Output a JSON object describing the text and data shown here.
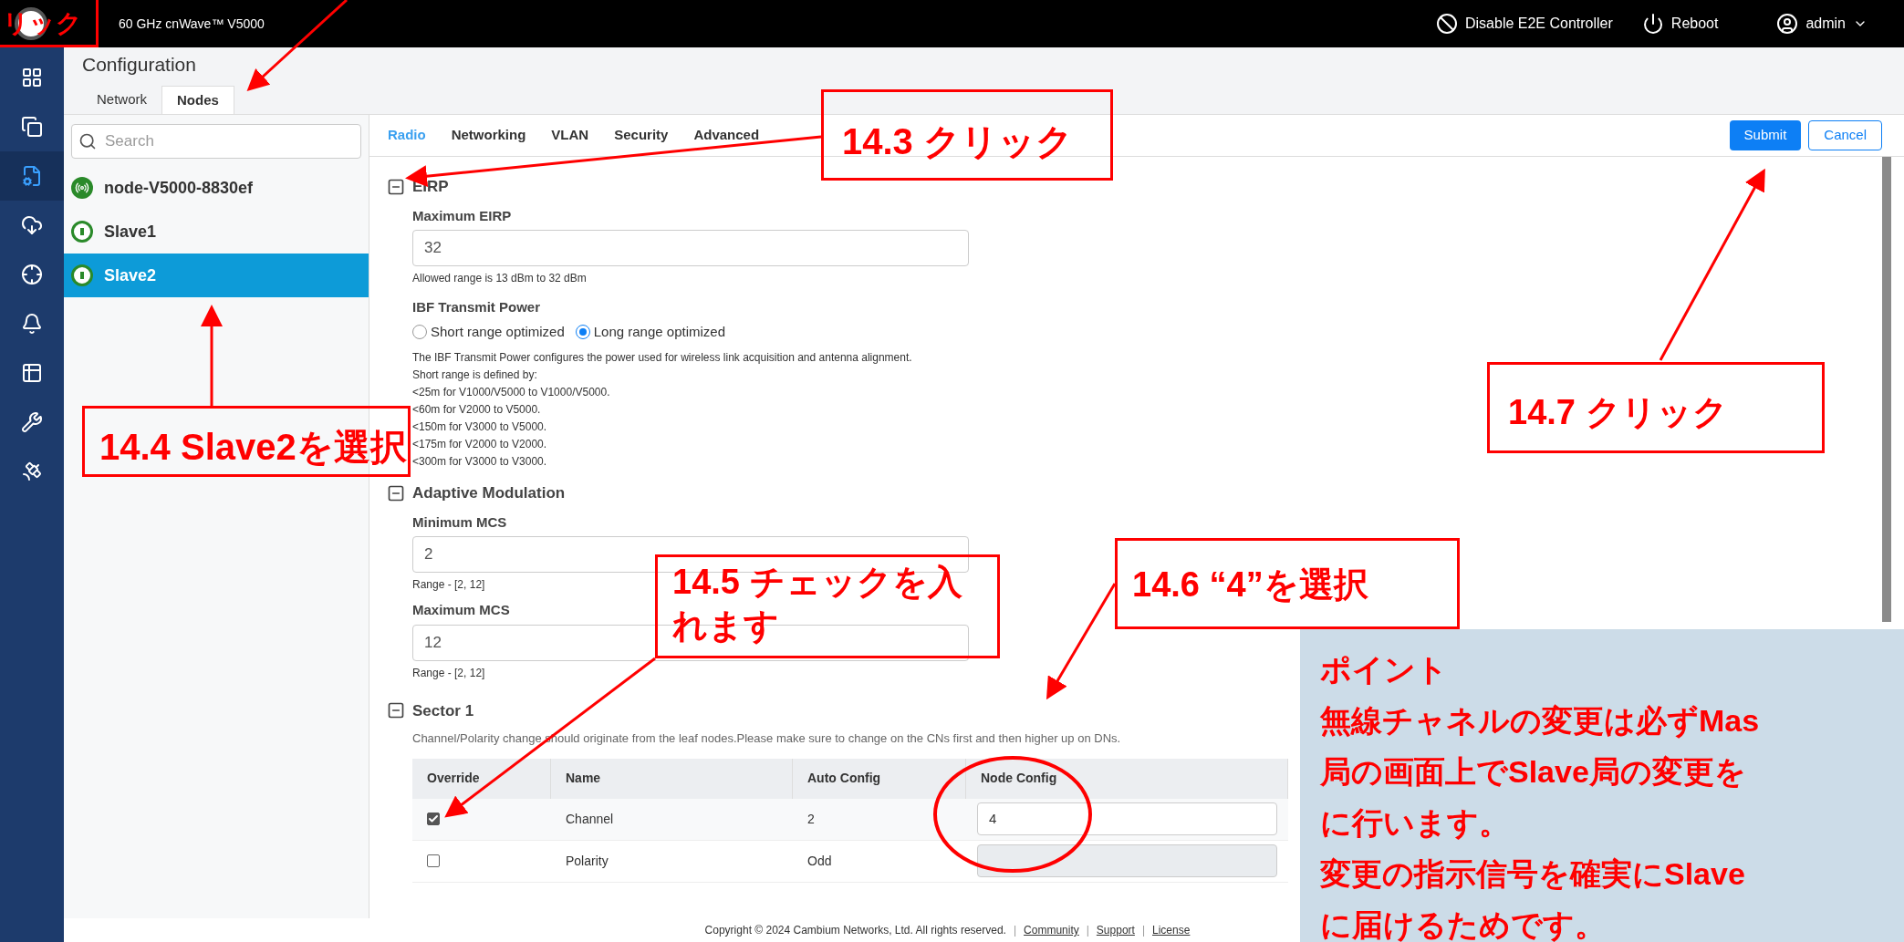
{
  "topbar": {
    "product": "60 GHz cnWave™ V5000",
    "actions": [
      "Disable E2E Controller",
      "Reboot"
    ],
    "user": "admin"
  },
  "nav": [
    {
      "selected": false
    },
    {
      "selected": false
    },
    {
      "selected": true
    },
    {
      "selected": false
    },
    {
      "selected": false
    },
    {
      "selected": false
    },
    {
      "selected": false
    },
    {
      "selected": false
    },
    {
      "selected": false
    }
  ],
  "page": {
    "title": "Configuration",
    "tabs": [
      {
        "label": "Network",
        "selected": false
      },
      {
        "label": "Nodes",
        "selected": true
      }
    ]
  },
  "nodes_panel": {
    "search": {
      "placeholder": "Search"
    },
    "nodes": [
      {
        "name": "node-V5000-8830ef",
        "kind": "pop",
        "selected": false
      },
      {
        "name": "Slave1",
        "kind": "cn",
        "selected": false
      },
      {
        "name": "Slave2",
        "kind": "cn",
        "selected": true
      }
    ]
  },
  "content_tabs": [
    {
      "label": "Radio",
      "selected": true
    },
    {
      "label": "Networking",
      "selected": false
    },
    {
      "label": "VLAN",
      "selected": false
    },
    {
      "label": "Security",
      "selected": false
    },
    {
      "label": "Advanced",
      "selected": false
    }
  ],
  "buttons": {
    "submit": "Submit",
    "cancel": "Cancel"
  },
  "eirp": {
    "title": "EIRP",
    "field_label": "Maximum EIRP",
    "value": "32",
    "hint": "Allowed range is 13 dBm to 32 dBm",
    "ibf_label": "IBF Transmit Power",
    "radios": [
      {
        "label": "Short range optimized",
        "selected": false
      },
      {
        "label": "Long range optimized",
        "selected": true
      }
    ],
    "description": [
      "The IBF Transmit Power configures the power used for wireless link acquisition and antenna alignment.",
      "Short range is defined by:",
      "<25m for V1000/V5000 to V1000/V5000.",
      "<60m for V2000 to V5000.",
      "<150m for V3000 to V5000.",
      "<175m for V2000 to V2000.",
      "<300m for V3000 to V3000."
    ]
  },
  "adaptive": {
    "title": "Adaptive Modulation",
    "fields": [
      {
        "label": "Minimum MCS",
        "value": "2",
        "hint": "Range - [2, 12]"
      },
      {
        "label": "Maximum MCS",
        "value": "12",
        "hint": "Range - [2, 12]"
      }
    ]
  },
  "sector": {
    "title": "Sector 1",
    "note": "Channel/Polarity change should originate from the leaf nodes.Please make sure to change on the CNs first and then higher up on DNs.",
    "columns": [
      "Override",
      "Name",
      "Auto Config",
      "Node Config"
    ],
    "rows": [
      {
        "checked": true,
        "name": "Channel",
        "auto": "2",
        "value": "4",
        "disabled": false
      },
      {
        "checked": false,
        "name": "Polarity",
        "auto": "Odd",
        "disabled": true
      }
    ]
  },
  "footer": {
    "copyright": "Copyright © 2024 Cambium Networks, Ltd. All rights reserved.",
    "links": [
      "Community",
      "Support",
      "License"
    ],
    "separator": "|"
  },
  "annotations": [
    {
      "kind": "corner",
      "text": "リック"
    },
    {
      "kind": "step3",
      "text": "14.3  クリック"
    },
    {
      "kind": "step4",
      "text": "14.4 Slave2を選択"
    },
    {
      "kind": "step5",
      "text": "14.5  チェックを入れます"
    },
    {
      "kind": "step6",
      "text": "14.6  “4”を選択"
    },
    {
      "kind": "step7",
      "text": "14.7  クリック"
    }
  ],
  "point_note": {
    "lines": [
      "ポイント",
      "無線チャネルの変更は必ずMas",
      "局の画面上でSlave局の変更を",
      "に行います。",
      "変更の指示信号を確実にSlave",
      "に届けるためです。"
    ]
  }
}
